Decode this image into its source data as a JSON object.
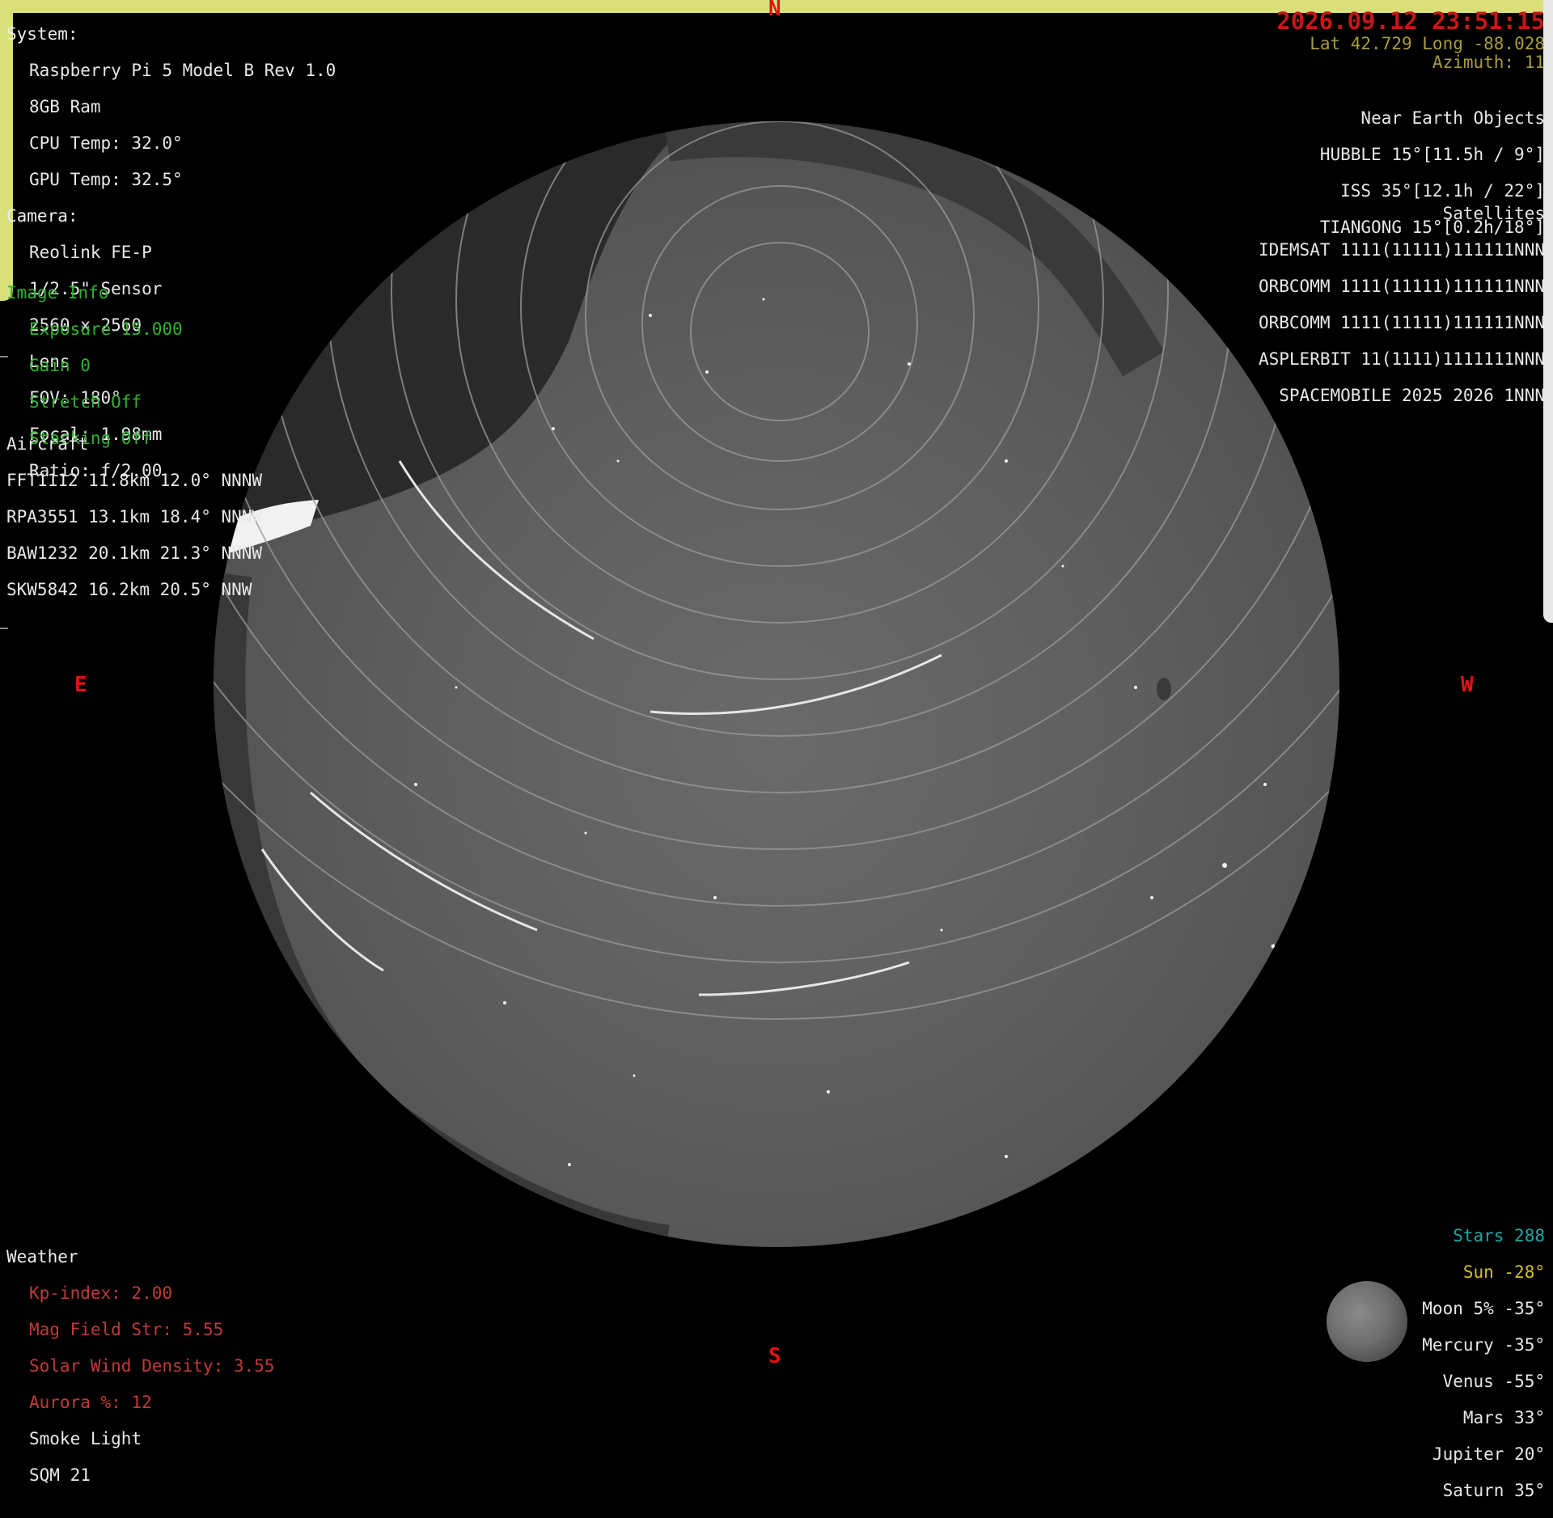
{
  "compass": {
    "north": "N",
    "south": "S",
    "east": "E",
    "west": "W"
  },
  "system": {
    "header": "System:",
    "board": "Raspberry Pi 5 Model B Rev 1.0",
    "ram": "8GB Ram",
    "cpu_temp": "CPU Temp: 32.0°",
    "gpu_temp": "GPU Temp: 32.5°"
  },
  "camera": {
    "header": "Camera:",
    "model": "Reolink FE-P",
    "sensor": "1/2.5\" Sensor",
    "resolution": "2560 x 2560",
    "lens_header": "Lens",
    "fov": "FOV: 180°",
    "focal": "Focal: 1.98mm",
    "ratio": "Ratio: f/2.00"
  },
  "image_info": {
    "header": "Image Info",
    "exposure": "Exposure 15.000",
    "gain": "Gain 0",
    "stretch": "Stretch Off",
    "stacking": "Stacking Off"
  },
  "aircraft": {
    "header": "Aircraft",
    "rows": [
      "FFT1112 11.8km 12.0° NNNW",
      "RPA3551 13.1km 18.4° NNNW",
      "BAW1232 20.1km 21.3° NNNW",
      "SKW5842 16.2km 20.5° NNW"
    ]
  },
  "weather": {
    "header": "Weather",
    "kp": "Kp-index: 2.00",
    "mag": "Mag Field Str: 5.55",
    "wind": "Solar Wind Density: 3.55",
    "aurora": "Aurora %: 12",
    "smoke": "Smoke Light",
    "sqm": "SQM 21"
  },
  "datetime": "2026.09.12 23:51:15",
  "location": "Lat 42.729 Long -88.028",
  "azimuth": "Azimuth: 11",
  "neo": {
    "header": "Near Earth Objects",
    "rows": [
      "HUBBLE 15°[11.5h / 9°]",
      "ISS 35°[12.1h / 22°]",
      "TIANGONG 15°[0.2h/18°]"
    ]
  },
  "satellites": {
    "header": "Satellites",
    "rows": [
      "IDEMSAT 1111(11111)111111NNN",
      "ORBCOMM 1111(11111)111111NNN",
      "ORBCOMM 1111(11111)111111NNN",
      "ASPLERBIT 11(1111)1111111NNN",
      "SPACEMOBILE 2025 2026 1NNN"
    ]
  },
  "planets": {
    "stars": "Stars 288",
    "sun": "Sun -28°",
    "moon": "Moon 5% -35°",
    "mercury": "Mercury -35°",
    "venus": "Venus -55°",
    "mars": "Mars 33°",
    "jupiter": "Jupiter 20°",
    "saturn": "Saturn 35°"
  },
  "colors": {
    "frame": "#d9e07a",
    "compass": "#e01414",
    "image_info": "#2fb52f",
    "weather": "#c03a3a",
    "stars": "#1fa7a7",
    "sun": "#d4c020"
  }
}
